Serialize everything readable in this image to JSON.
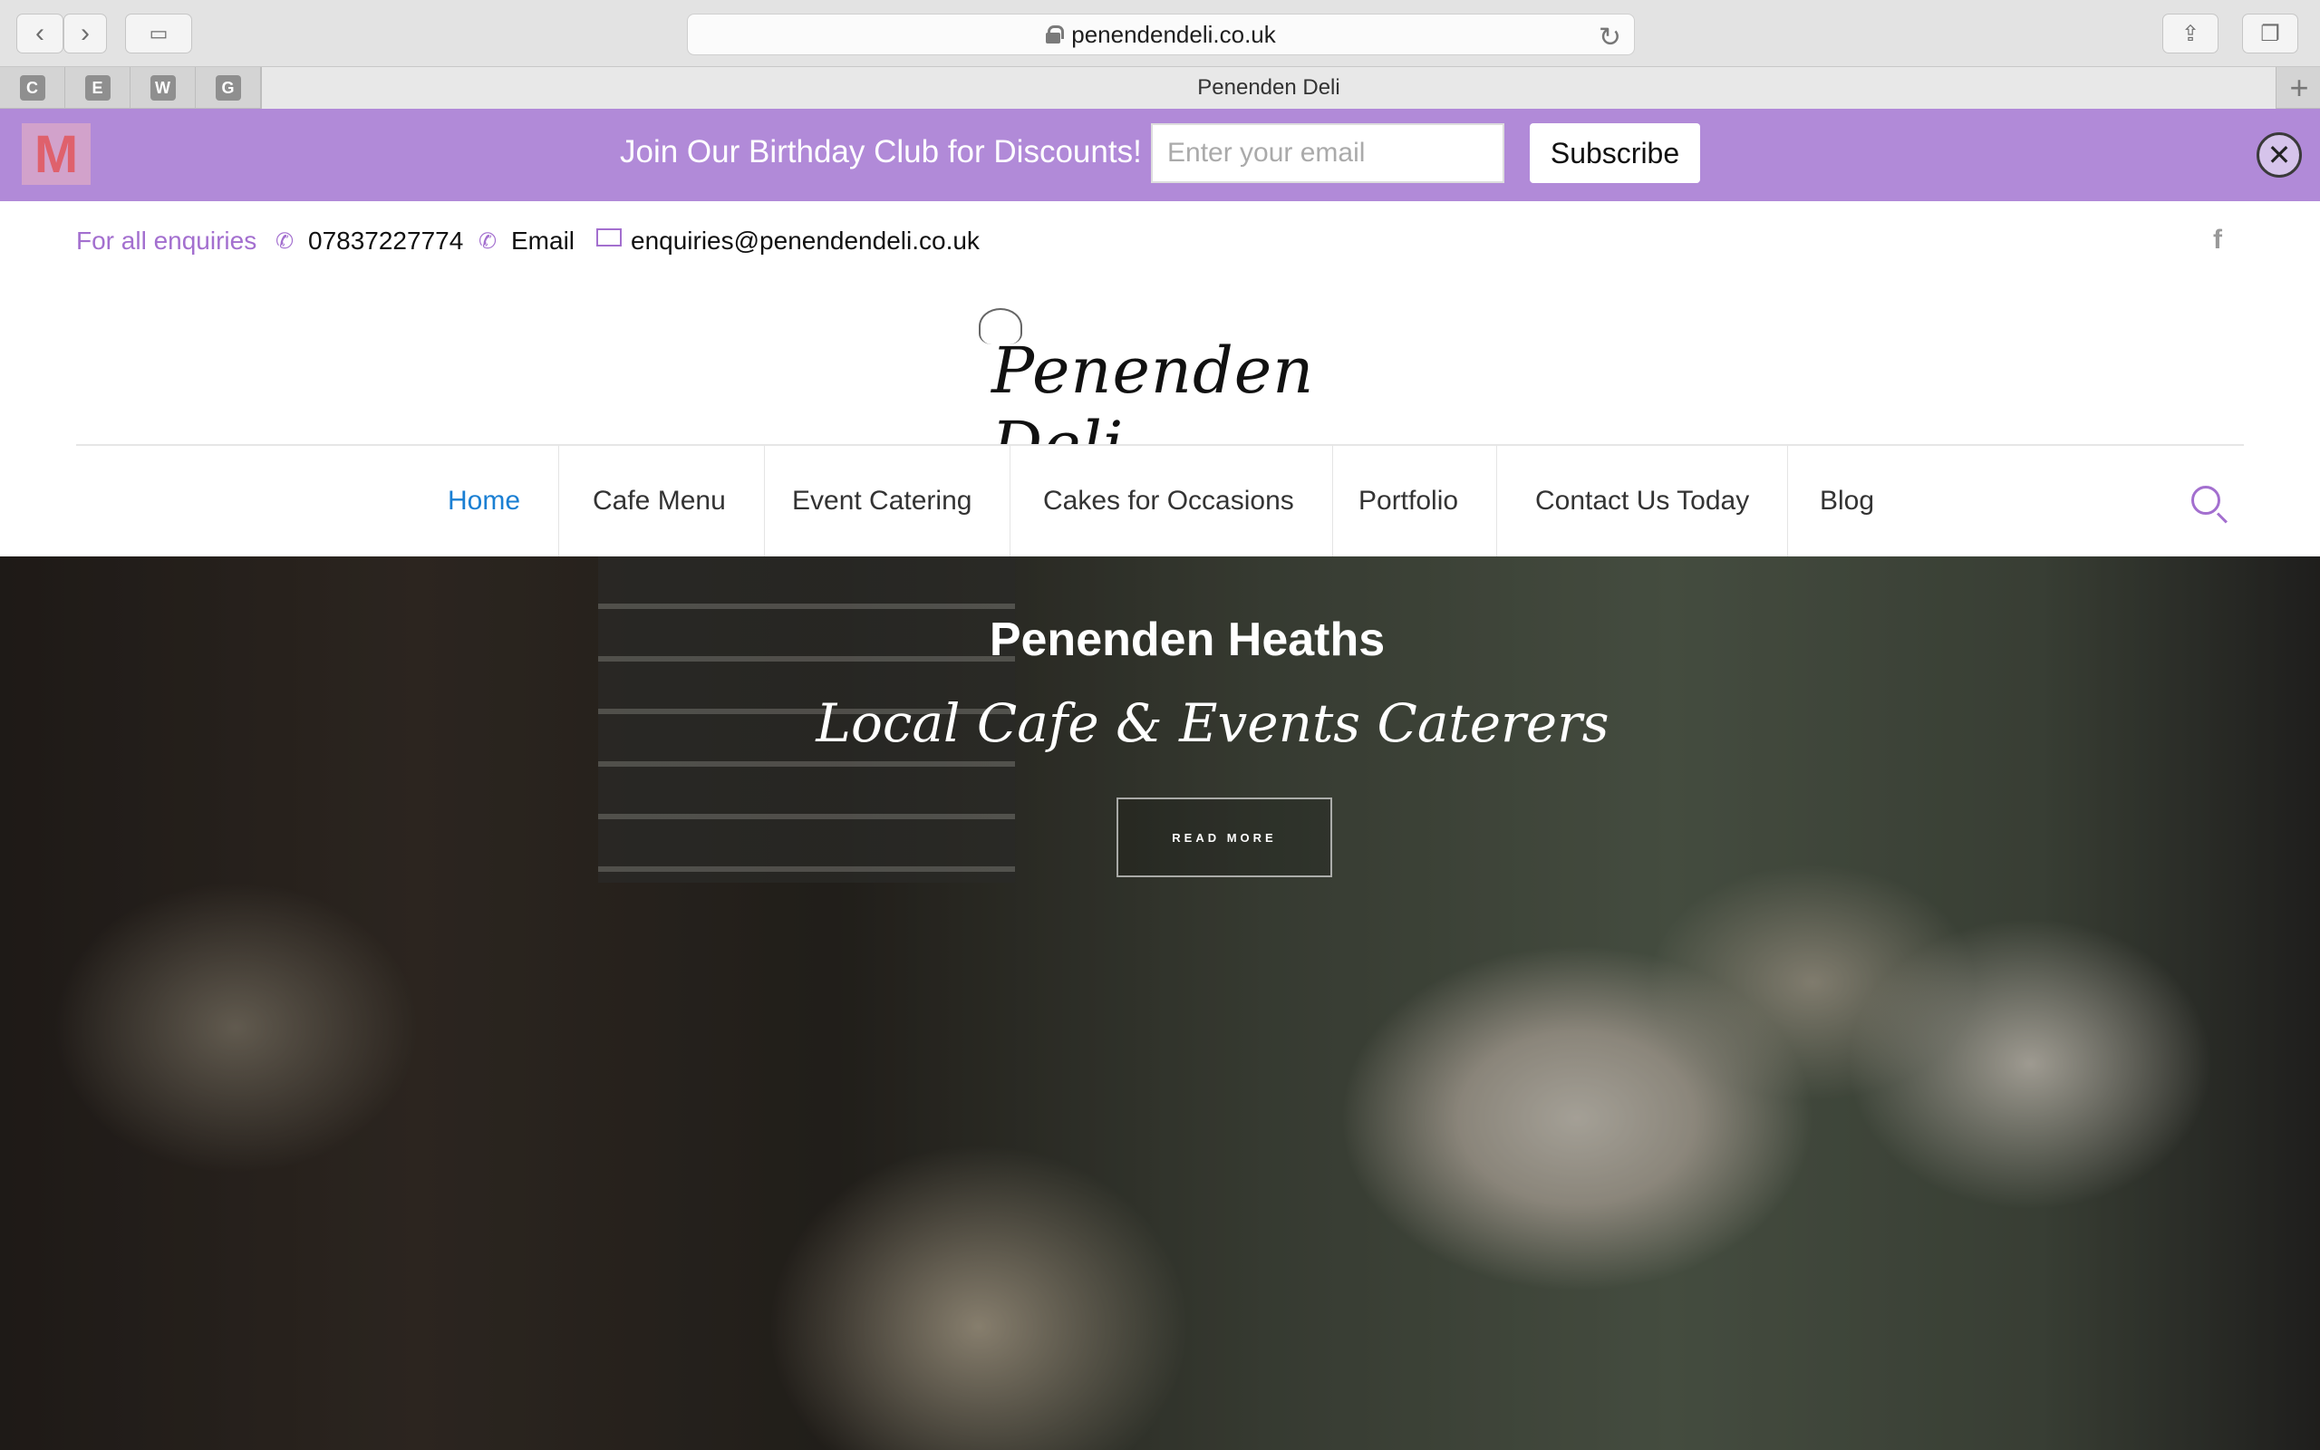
{
  "browser": {
    "url": "penendendeli.co.uk",
    "tab_title": "Penenden Deli",
    "favorites": [
      "C",
      "E",
      "W",
      "G"
    ]
  },
  "banner": {
    "logo_letter": "M",
    "text": "Join Our Birthday Club for Discounts!",
    "email_placeholder": "Enter your email",
    "subscribe_label": "Subscribe"
  },
  "contact": {
    "label": "For all enquiries",
    "phone": "07837227774",
    "email_label": "Email",
    "email": "enquiries@penendendeli.co.uk"
  },
  "logo": {
    "text": "Penenden Deli"
  },
  "nav": {
    "items": [
      "Home",
      "Cafe Menu",
      "Event Catering",
      "Cakes for Occasions",
      "Portfolio",
      "Contact Us Today",
      "Blog"
    ],
    "active": "Home"
  },
  "hero": {
    "title": "Penenden Heaths",
    "subtitle": "Local Cafe & Events Caterers",
    "button_label": "READ MORE"
  },
  "colors": {
    "accent_purple": "#b18ad8",
    "label_purple": "#a36fcf",
    "nav_active": "#1a7fd3"
  }
}
